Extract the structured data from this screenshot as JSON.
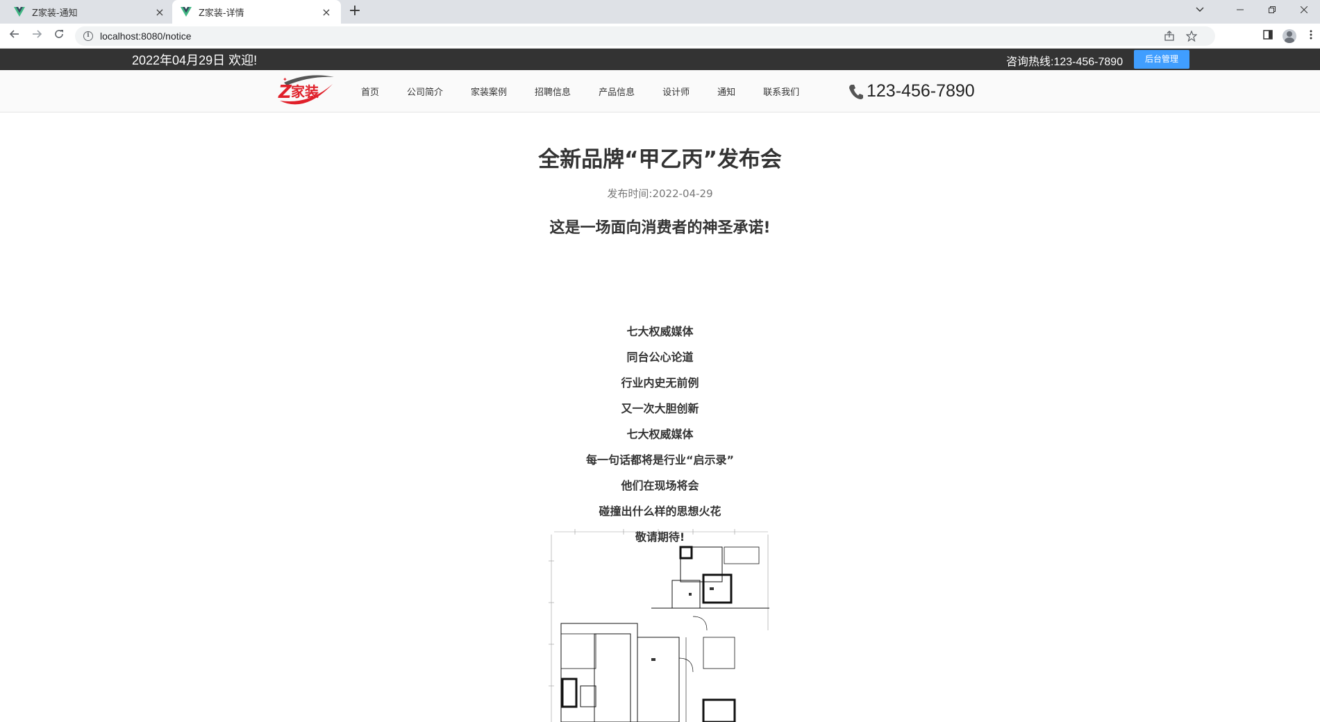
{
  "browser": {
    "tabs": [
      {
        "title": "Z家装-通知",
        "active": false
      },
      {
        "title": "Z家装-详情",
        "active": true
      }
    ],
    "url": "localhost:8080/notice",
    "new_tab": "+",
    "close_glyph": "×"
  },
  "topbar": {
    "date_welcome": "2022年04月29日 欢迎!",
    "hotline": "咨询热线:123-456-7890",
    "admin_button": "后台管理",
    "background": "#333333",
    "button_color": "#409eff"
  },
  "nav": {
    "logo_text": "Z家装",
    "menu": [
      "首页",
      "公司简介",
      "家装案例",
      "招聘信息",
      "产品信息",
      "设计师",
      "通知",
      "联系我们"
    ],
    "phone": "123-456-7890",
    "phone_icon": "phone-icon"
  },
  "article": {
    "title": "全新品牌“甲乙丙”发布会",
    "publish_label": "发布时间:",
    "publish_date": "2022-04-29",
    "subtitle": "这是一场面向消费者的神圣承诺!",
    "lines": [
      "七大权威媒体",
      "同台公心论道",
      "行业内史无前例",
      "又一次大胆创新",
      "七大权威媒体",
      "每一句话都将是行业“启示录”",
      "他们在现场将会",
      "碰撞出什么样的思想火花",
      "敬请期待!"
    ],
    "image": "floor-plan-image"
  }
}
